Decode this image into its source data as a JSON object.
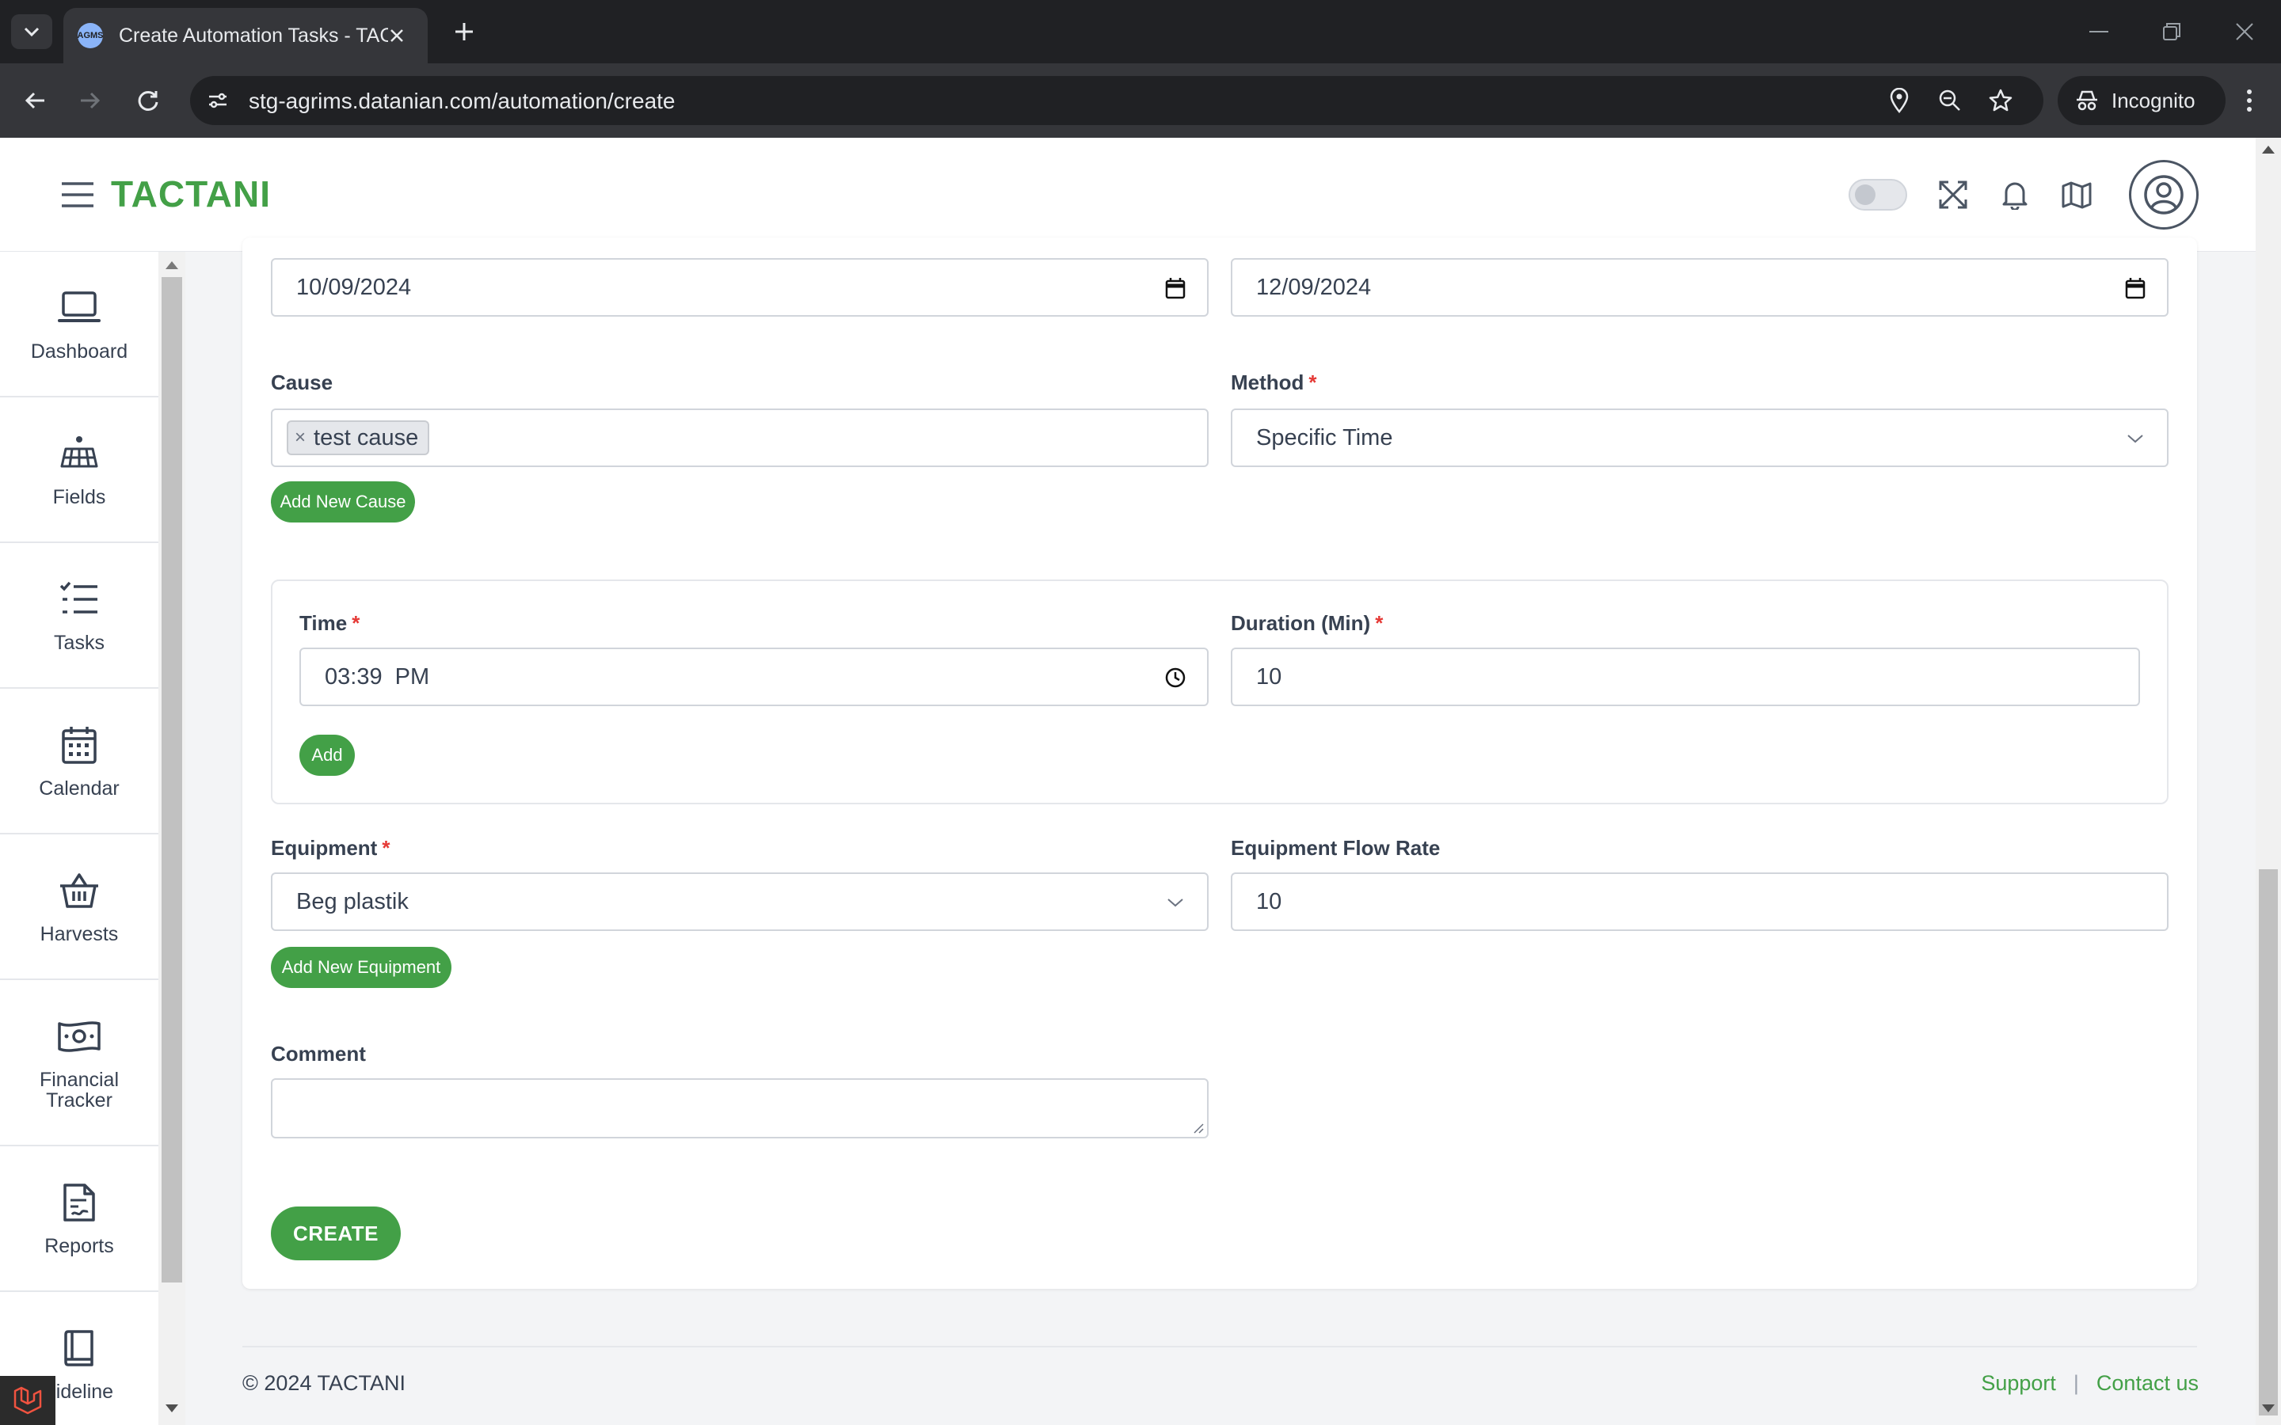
{
  "browser": {
    "tab_title": "Create Automation Tasks - TACTANI",
    "favicon_text": "AGMS",
    "url": "stg-agrims.datanian.com/automation/create",
    "incognito_label": "Incognito",
    "icons": [
      "tab-list-icon",
      "close-icon",
      "plus-icon",
      "minimize-icon",
      "restore-icon",
      "window-close-icon",
      "back-icon",
      "forward-icon",
      "reload-icon",
      "site-info-icon",
      "location-icon",
      "zoom-icon",
      "bookmark-star-icon",
      "incognito-icon",
      "more-vert-icon"
    ]
  },
  "header": {
    "brand": "TACTANI",
    "theme_toggle_on": false,
    "icons": [
      "hamburger-icon",
      "fullscreen-icon",
      "bell-icon",
      "map-icon",
      "user-avatar-icon"
    ]
  },
  "sidebar": {
    "items": [
      {
        "label": "Dashboard",
        "icon": "laptop-icon"
      },
      {
        "label": "Fields",
        "icon": "solar-panel-icon"
      },
      {
        "label": "Tasks",
        "icon": "task-list-icon"
      },
      {
        "label": "Calendar",
        "icon": "calendar-icon"
      },
      {
        "label": "Harvests",
        "icon": "basket-icon"
      },
      {
        "label": "Financial Tracker",
        "icon": "money-icon"
      },
      {
        "label": "Reports",
        "icon": "report-icon"
      },
      {
        "label": "uideline",
        "icon": "book-icon"
      }
    ]
  },
  "form": {
    "start_date": "10/09/2024",
    "end_date": "12/09/2024",
    "cause": {
      "label": "Cause",
      "chips": [
        "test cause"
      ],
      "chip_remove": "×",
      "add_button": "Add New Cause"
    },
    "method": {
      "label": "Method",
      "required_mark": "*",
      "value": "Specific Time"
    },
    "time": {
      "label": "Time",
      "required_mark": "*",
      "value": "03:39  PM",
      "add_button": "Add"
    },
    "duration": {
      "label": "Duration (Min)",
      "required_mark": "*",
      "value": "10"
    },
    "equipment": {
      "label": "Equipment",
      "required_mark": "*",
      "value": "Beg plastik",
      "add_button": "Add New Equipment"
    },
    "flow_rate": {
      "label": "Equipment Flow Rate",
      "value": "10"
    },
    "comment": {
      "label": "Comment",
      "value": ""
    },
    "submit": "CREATE"
  },
  "footer": {
    "copyright": "© 2024 TACTANI",
    "links": [
      "Support",
      "Contact us"
    ],
    "separator": "|"
  },
  "colors": {
    "brand_green": "#43a047",
    "required_red": "#e53935",
    "chrome_dark": "#202124",
    "chrome_toolbar": "#35363a"
  }
}
